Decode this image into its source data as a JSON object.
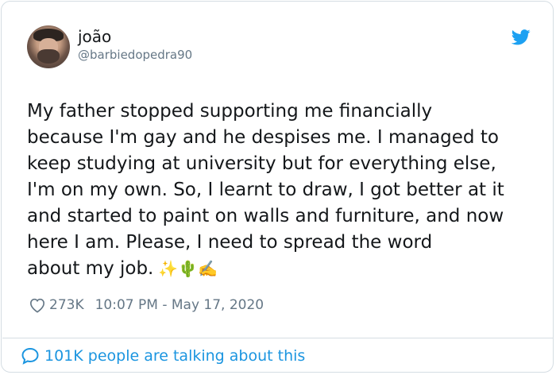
{
  "author": {
    "name": "joão",
    "handle": "@barbiedopedra90"
  },
  "tweet": {
    "lines": [
      "My father stopped supporting me financially",
      "because I'm gay and he despises me. I managed to",
      "keep studying at university but for everything else,",
      "I'm on my own. So, I learnt to draw, I got better at it",
      "and started to paint on walls and furniture, and now",
      "here I am. Please, I need to spread the word",
      "about my job."
    ],
    "emojis": "✨🌵✍️"
  },
  "meta": {
    "likes": "273K",
    "time": "10:07 PM - May 17, 2020"
  },
  "footer": {
    "talking": "101K people are talking about this"
  },
  "colors": {
    "twitter_blue": "#1da1f2",
    "link_blue": "#1b95e0",
    "secondary_text": "#657786",
    "border": "#d5dde3"
  }
}
